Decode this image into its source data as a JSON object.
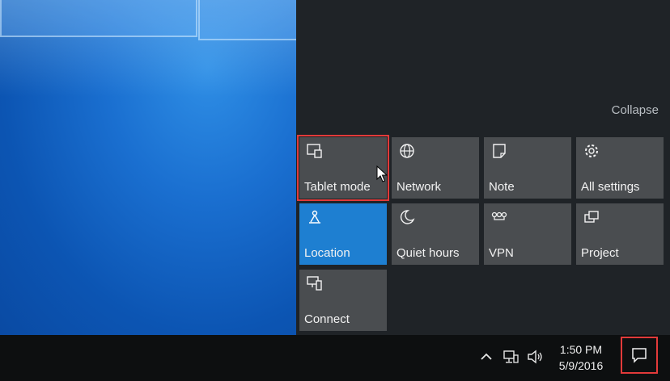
{
  "action_center": {
    "collapse_label": "Collapse",
    "tiles": [
      {
        "label": "Tablet mode",
        "icon": "tablet-mode-icon",
        "state": "highlighted"
      },
      {
        "label": "Network",
        "icon": "network-globe-icon"
      },
      {
        "label": "Note",
        "icon": "note-icon"
      },
      {
        "label": "All settings",
        "icon": "gear-icon"
      },
      {
        "label": "Location",
        "icon": "location-icon",
        "state": "active"
      },
      {
        "label": "Quiet hours",
        "icon": "moon-icon"
      },
      {
        "label": "VPN",
        "icon": "vpn-icon"
      },
      {
        "label": "Project",
        "icon": "project-icon"
      },
      {
        "label": "Connect",
        "icon": "connect-icon"
      }
    ]
  },
  "taskbar": {
    "time": "1:50 PM",
    "date": "5/9/2016"
  },
  "colors": {
    "accent": "#1e7fd1",
    "tile": "#4a4d50",
    "highlight": "#e23a3a",
    "panel": "#1f2327"
  }
}
